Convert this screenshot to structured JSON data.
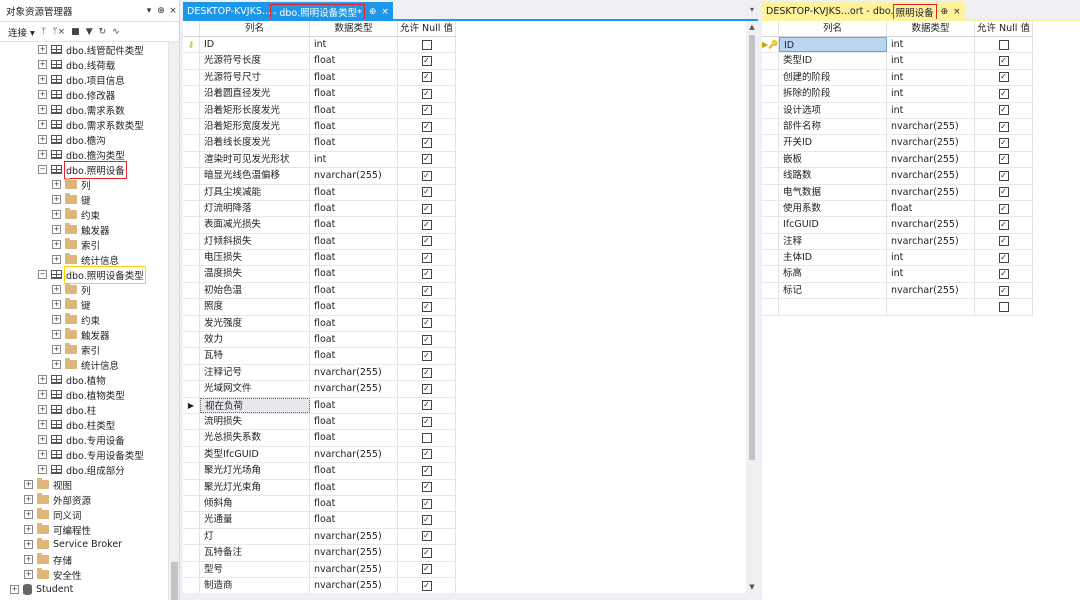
{
  "explorer": {
    "title": "对象资源管理器",
    "title_icons": [
      "pin-icon",
      "dropdown-icon",
      "close-icon"
    ],
    "toolbar": {
      "connect_label": "连接",
      "icons": [
        "connect-icon",
        "disconnect-icon",
        "stop-icon",
        "filter-icon",
        "refresh-icon",
        "activity-icon"
      ]
    },
    "tree": [
      {
        "label": "dbo.线管配件类型",
        "icon": "table",
        "indent": 38,
        "exp": "+"
      },
      {
        "label": "dbo.线荷载",
        "icon": "table",
        "indent": 38,
        "exp": "+"
      },
      {
        "label": "dbo.项目信息",
        "icon": "table",
        "indent": 38,
        "exp": "+"
      },
      {
        "label": "dbo.修改器",
        "icon": "table",
        "indent": 38,
        "exp": "+"
      },
      {
        "label": "dbo.需求系数",
        "icon": "table",
        "indent": 38,
        "exp": "+"
      },
      {
        "label": "dbo.需求系数类型",
        "icon": "table",
        "indent": 38,
        "exp": "+"
      },
      {
        "label": "dbo.檐沟",
        "icon": "table",
        "indent": 38,
        "exp": "+"
      },
      {
        "label": "dbo.檐沟类型",
        "icon": "table",
        "indent": 38,
        "exp": "+"
      },
      {
        "label": "dbo.照明设备",
        "icon": "table",
        "indent": 38,
        "exp": "−",
        "highlight": "red"
      },
      {
        "label": "列",
        "icon": "folder",
        "indent": 52,
        "exp": "+"
      },
      {
        "label": "键",
        "icon": "folder",
        "indent": 52,
        "exp": "+"
      },
      {
        "label": "约束",
        "icon": "folder",
        "indent": 52,
        "exp": "+"
      },
      {
        "label": "触发器",
        "icon": "folder",
        "indent": 52,
        "exp": "+"
      },
      {
        "label": "索引",
        "icon": "folder",
        "indent": 52,
        "exp": "+"
      },
      {
        "label": "统计信息",
        "icon": "folder",
        "indent": 52,
        "exp": "+"
      },
      {
        "label": "dbo.照明设备类型",
        "icon": "table",
        "indent": 38,
        "exp": "−",
        "highlight": "yellow"
      },
      {
        "label": "列",
        "icon": "folder",
        "indent": 52,
        "exp": "+"
      },
      {
        "label": "键",
        "icon": "folder",
        "indent": 52,
        "exp": "+"
      },
      {
        "label": "约束",
        "icon": "folder",
        "indent": 52,
        "exp": "+"
      },
      {
        "label": "触发器",
        "icon": "folder",
        "indent": 52,
        "exp": "+"
      },
      {
        "label": "索引",
        "icon": "folder",
        "indent": 52,
        "exp": "+"
      },
      {
        "label": "统计信息",
        "icon": "folder",
        "indent": 52,
        "exp": "+"
      },
      {
        "label": "dbo.植物",
        "icon": "table",
        "indent": 38,
        "exp": "+"
      },
      {
        "label": "dbo.植物类型",
        "icon": "table",
        "indent": 38,
        "exp": "+"
      },
      {
        "label": "dbo.柱",
        "icon": "table",
        "indent": 38,
        "exp": "+"
      },
      {
        "label": "dbo.柱类型",
        "icon": "table",
        "indent": 38,
        "exp": "+"
      },
      {
        "label": "dbo.专用设备",
        "icon": "table",
        "indent": 38,
        "exp": "+"
      },
      {
        "label": "dbo.专用设备类型",
        "icon": "table",
        "indent": 38,
        "exp": "+"
      },
      {
        "label": "dbo.组成部分",
        "icon": "table",
        "indent": 38,
        "exp": "+"
      },
      {
        "label": "视图",
        "icon": "folder",
        "indent": 24,
        "exp": "+"
      },
      {
        "label": "外部资源",
        "icon": "folder",
        "indent": 24,
        "exp": "+"
      },
      {
        "label": "同义词",
        "icon": "folder",
        "indent": 24,
        "exp": "+"
      },
      {
        "label": "可编程性",
        "icon": "folder",
        "indent": 24,
        "exp": "+"
      },
      {
        "label": "Service Broker",
        "icon": "folder",
        "indent": 24,
        "exp": "+"
      },
      {
        "label": "存储",
        "icon": "folder",
        "indent": 24,
        "exp": "+"
      },
      {
        "label": "安全性",
        "icon": "folder",
        "indent": 24,
        "exp": "+"
      },
      {
        "label": "Student",
        "icon": "database",
        "indent": 10,
        "exp": "+"
      }
    ]
  },
  "doc1": {
    "tab_prefix": "DESKTOP-KVJKS...",
    "tab_highlight": "- dbo.照明设备类型*",
    "tab_pin": "⊕",
    "tab_close": "×",
    "trail": "▾",
    "headers": {
      "name": "列名",
      "type": "数据类型",
      "nullable": "允许 Null 值"
    },
    "rows": [
      {
        "name": "ID",
        "type": "int",
        "null": false,
        "key": true
      },
      {
        "name": "光源符号长度",
        "type": "float",
        "null": true
      },
      {
        "name": "光源符号尺寸",
        "type": "float",
        "null": true
      },
      {
        "name": "沿着圆直径发光",
        "type": "float",
        "null": true
      },
      {
        "name": "沿着矩形长度发光",
        "type": "float",
        "null": true
      },
      {
        "name": "沿着矩形宽度发光",
        "type": "float",
        "null": true
      },
      {
        "name": "沿着线长度发光",
        "type": "float",
        "null": true
      },
      {
        "name": "渲染时可见发光形状",
        "type": "int",
        "null": true
      },
      {
        "name": "暗显光线色温偏移",
        "type": "nvarchar(255)",
        "null": true
      },
      {
        "name": "灯具尘埃减能",
        "type": "float",
        "null": true
      },
      {
        "name": "灯流明降落",
        "type": "float",
        "null": true
      },
      {
        "name": "表面减光损失",
        "type": "float",
        "null": true
      },
      {
        "name": "灯倾斜损失",
        "type": "float",
        "null": true
      },
      {
        "name": "电压损失",
        "type": "float",
        "null": true
      },
      {
        "name": "温度损失",
        "type": "float",
        "null": true
      },
      {
        "name": "初始色温",
        "type": "float",
        "null": true
      },
      {
        "name": "照度",
        "type": "float",
        "null": true
      },
      {
        "name": "发光强度",
        "type": "float",
        "null": true
      },
      {
        "name": "效力",
        "type": "float",
        "null": true
      },
      {
        "name": "瓦特",
        "type": "float",
        "null": true
      },
      {
        "name": "注释记号",
        "type": "nvarchar(255)",
        "null": true
      },
      {
        "name": "光域网文件",
        "type": "nvarchar(255)",
        "null": true
      },
      {
        "name": "视在负荷",
        "type": "float",
        "null": true,
        "current": true
      },
      {
        "name": "流明损失",
        "type": "float",
        "null": true
      },
      {
        "name": "光总损失系数",
        "type": "float",
        "null": false
      },
      {
        "name": "类型IfcGUID",
        "type": "nvarchar(255)",
        "null": true
      },
      {
        "name": "聚光灯光场角",
        "type": "float",
        "null": true
      },
      {
        "name": "聚光灯光束角",
        "type": "float",
        "null": true
      },
      {
        "name": "倾斜角",
        "type": "float",
        "null": true
      },
      {
        "name": "光通量",
        "type": "float",
        "null": true
      },
      {
        "name": "灯",
        "type": "nvarchar(255)",
        "null": true
      },
      {
        "name": "瓦特备注",
        "type": "nvarchar(255)",
        "null": true
      },
      {
        "name": "型号",
        "type": "nvarchar(255)",
        "null": true
      },
      {
        "name": "制造商",
        "type": "nvarchar(255)",
        "null": true
      }
    ]
  },
  "doc2": {
    "tab_prefix": "DESKTOP-KVJKS...ort - dbo.",
    "tab_highlight": "照明设备",
    "tab_pin": "⊕",
    "tab_close": "×",
    "headers": {
      "name": "列名",
      "type": "数据类型",
      "nullable": "允许 Null 值"
    },
    "rows": [
      {
        "name": "ID",
        "type": "int",
        "null": false,
        "key": true,
        "current": true
      },
      {
        "name": "类型ID",
        "type": "int",
        "null": true
      },
      {
        "name": "创建的阶段",
        "type": "int",
        "null": true
      },
      {
        "name": "拆除的阶段",
        "type": "int",
        "null": true
      },
      {
        "name": "设计选项",
        "type": "int",
        "null": true
      },
      {
        "name": "部件名称",
        "type": "nvarchar(255)",
        "null": true
      },
      {
        "name": "开关ID",
        "type": "nvarchar(255)",
        "null": true
      },
      {
        "name": "嵌板",
        "type": "nvarchar(255)",
        "null": true
      },
      {
        "name": "线路数",
        "type": "nvarchar(255)",
        "null": true
      },
      {
        "name": "电气数据",
        "type": "nvarchar(255)",
        "null": true
      },
      {
        "name": "使用系数",
        "type": "float",
        "null": true
      },
      {
        "name": "IfcGUID",
        "type": "nvarchar(255)",
        "null": true
      },
      {
        "name": "注释",
        "type": "nvarchar(255)",
        "null": true
      },
      {
        "name": "主体ID",
        "type": "int",
        "null": true
      },
      {
        "name": "标高",
        "type": "int",
        "null": true
      },
      {
        "name": "标记",
        "type": "nvarchar(255)",
        "null": true
      },
      {
        "name": "",
        "type": "",
        "null": false
      }
    ]
  }
}
